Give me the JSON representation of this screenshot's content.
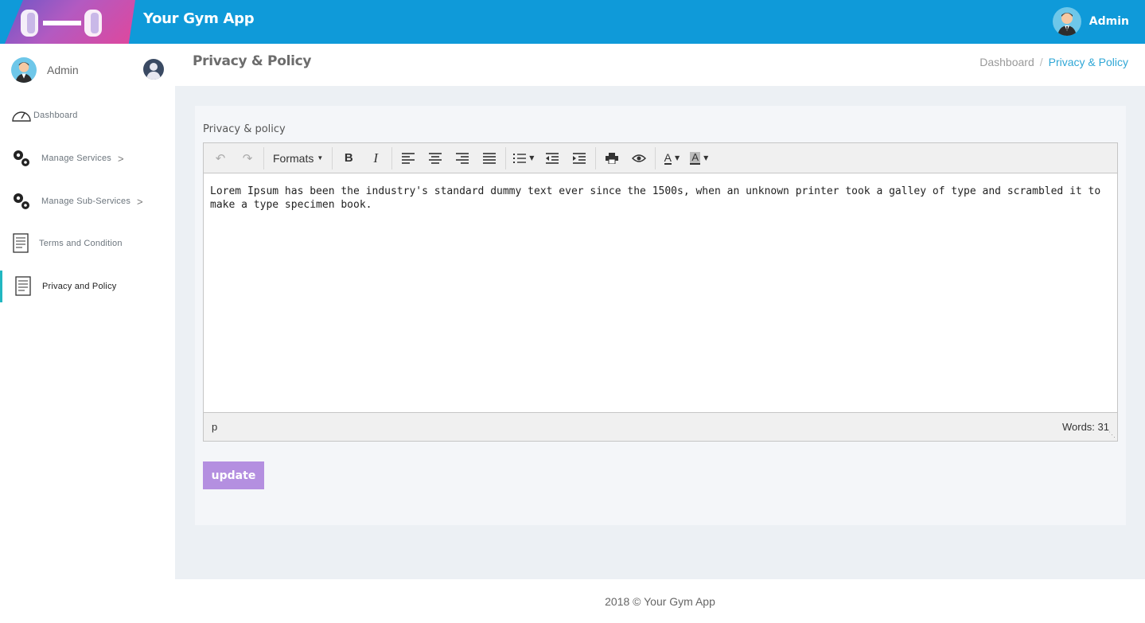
{
  "app": {
    "title": "Your Gym App",
    "user_name": "Admin"
  },
  "sidebar": {
    "user_name": "Admin",
    "items": [
      {
        "label": "Dashboard",
        "icon": "speedometer-icon"
      },
      {
        "label": "Manage Services",
        "icon": "gears-icon",
        "chevron": ">"
      },
      {
        "label": "Manage Sub-Services",
        "icon": "gears-icon",
        "chevron": ">"
      },
      {
        "label": "Terms and Condition",
        "icon": "document-icon"
      },
      {
        "label": "Privacy and Policy",
        "icon": "document-icon",
        "active": true
      }
    ]
  },
  "header": {
    "title": "Privacy & Policy",
    "breadcrumb": [
      "Dashboard",
      "/",
      "Privacy & Policy"
    ]
  },
  "form": {
    "label": "Privacy & policy",
    "toolbar": {
      "formats_label": "Formats"
    },
    "content": "Lorem Ipsum has been the industry's standard dummy text ever since the 1500s, when an unknown printer took a galley of type and scrambled it to make a type specimen book.",
    "status_path": "p",
    "word_count": "Words: 31",
    "submit_label": "update"
  },
  "footer": {
    "text": "2018 © Your Gym App"
  },
  "colors": {
    "topbar": "#0f9ad9",
    "accent": "#22b7c1",
    "button": "#b48fe0",
    "breadcrumb_active": "#2fa7d6"
  }
}
